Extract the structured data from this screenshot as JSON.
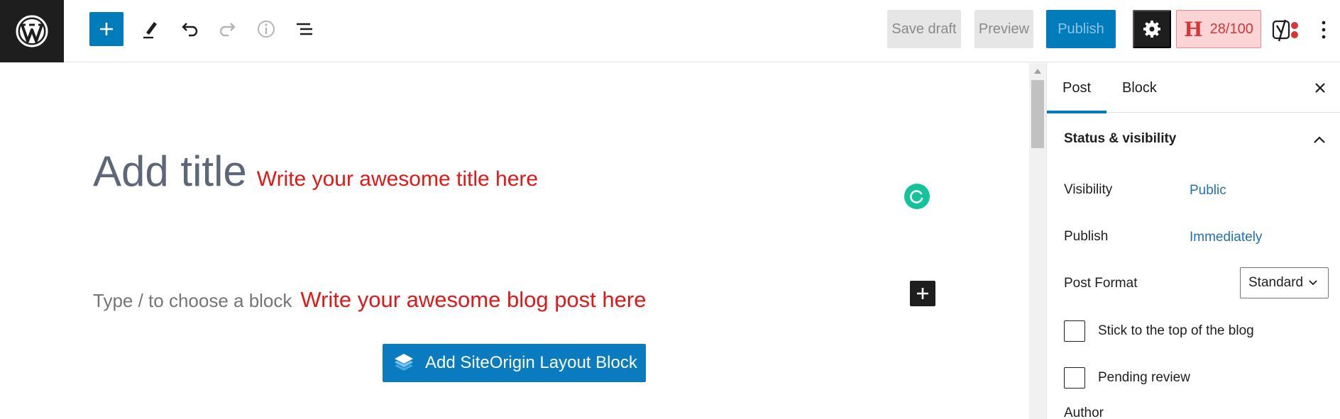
{
  "toolbar": {
    "save_draft": "Save draft",
    "preview": "Preview",
    "publish": "Publish",
    "seo_score_letter": "H",
    "seo_score": "28/100",
    "icons": [
      "wordpress-logo",
      "plus-icon",
      "pencil-icon",
      "undo-icon",
      "redo-icon",
      "info-icon",
      "list-view-icon",
      "gear-icon",
      "yoast-icon",
      "more-vertical-icon"
    ]
  },
  "editor": {
    "title_placeholder": "Add title",
    "title_hint": "Write your awesome title here",
    "block_placeholder": "Type / to choose a block",
    "block_hint": "Write your awesome blog post here",
    "siteorigin_button": "Add SiteOrigin Layout Block"
  },
  "sidebar": {
    "tabs": [
      {
        "label": "Post"
      },
      {
        "label": "Block"
      }
    ],
    "panel_title": "Status & visibility",
    "visibility_label": "Visibility",
    "visibility_value": "Public",
    "publish_label": "Publish",
    "publish_value": "Immediately",
    "post_format_label": "Post Format",
    "post_format_value": "Standard",
    "sticky_label": "Stick to the top of the blog",
    "pending_label": "Pending review",
    "author_label": "Author"
  },
  "colors": {
    "accent": "#007cba",
    "hint_red": "#e01818",
    "dark": "#1e1e1e",
    "grammarly": "#15c39a",
    "score_bg": "#fbd5d5"
  }
}
